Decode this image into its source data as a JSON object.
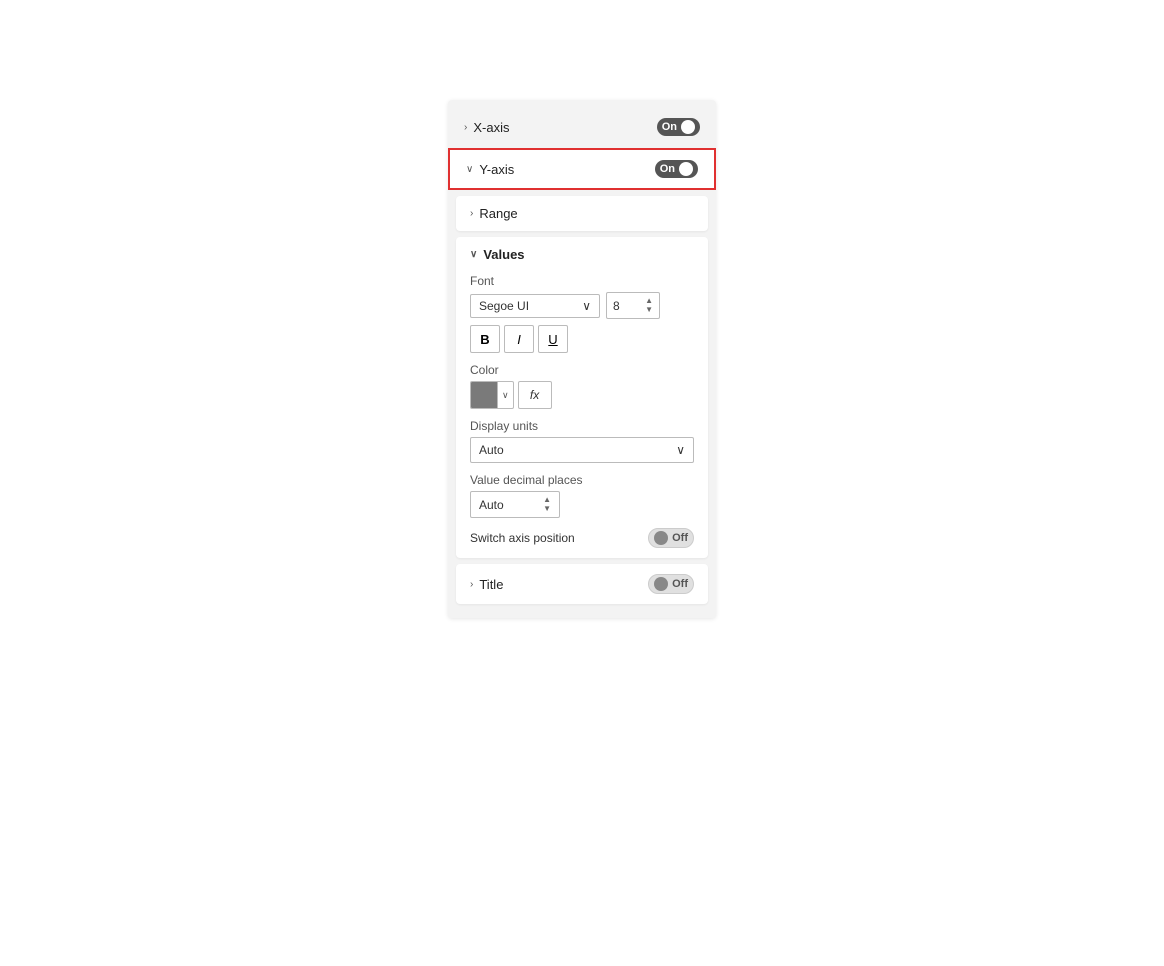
{
  "panel": {
    "xaxis": {
      "label": "X-axis",
      "toggle_label": "On",
      "toggle_state": "on"
    },
    "yaxis": {
      "label": "Y-axis",
      "toggle_label": "On",
      "toggle_state": "on"
    },
    "range": {
      "label": "Range"
    },
    "values": {
      "label": "Values",
      "font_label": "Font",
      "font_name": "Segoe UI",
      "font_size": "8",
      "bold_label": "B",
      "italic_label": "I",
      "underline_label": "U",
      "color_label": "Color",
      "fx_label": "fx",
      "display_units_label": "Display units",
      "display_units_value": "Auto",
      "decimal_label": "Value decimal places",
      "decimal_value": "Auto",
      "switch_axis_label": "Switch axis position",
      "switch_toggle_label": "Off",
      "switch_toggle_state": "off"
    },
    "title": {
      "label": "Title",
      "toggle_label": "Off",
      "toggle_state": "off"
    }
  },
  "icons": {
    "chevron_right": "›",
    "chevron_down": "˅",
    "chevron_expand": "∨",
    "up_arrow": "▲",
    "down_arrow": "▼",
    "dropdown_arrow": "⌄"
  }
}
